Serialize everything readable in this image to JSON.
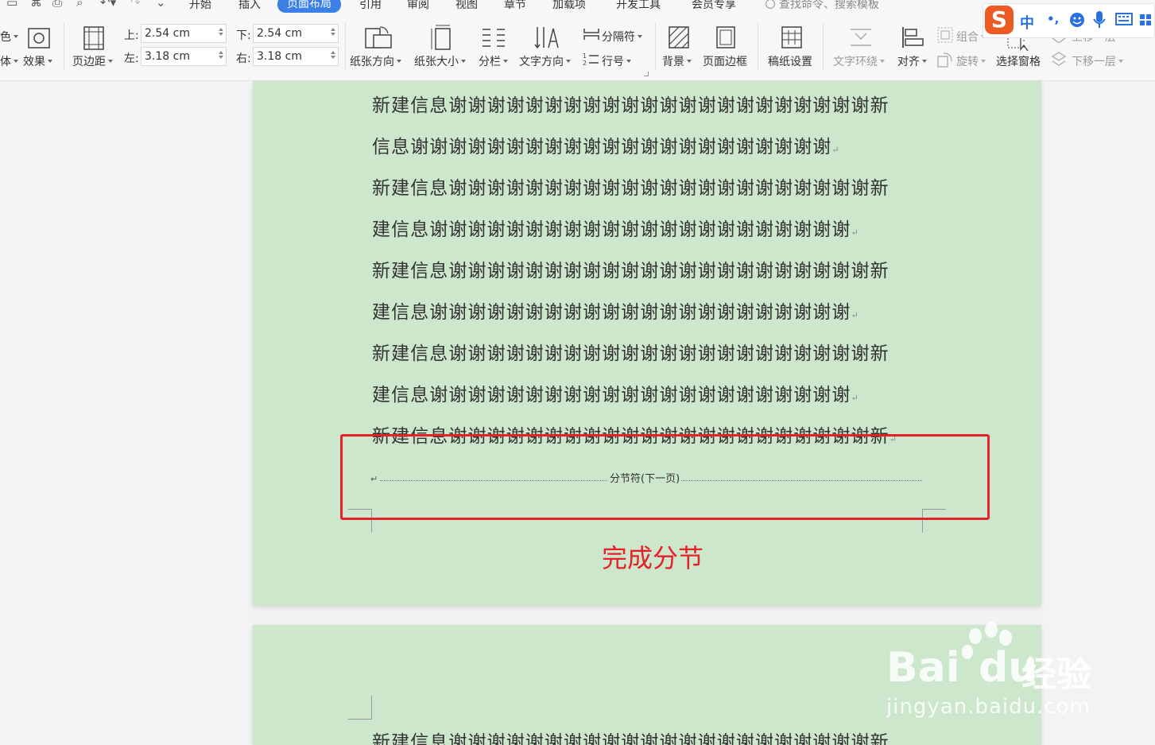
{
  "tabs": [
    {
      "label": "开始",
      "active": false
    },
    {
      "label": "插入",
      "active": false
    },
    {
      "label": "页面布局",
      "active": true
    },
    {
      "label": "引用",
      "active": false
    },
    {
      "label": "审阅",
      "active": false
    },
    {
      "label": "视图",
      "active": false
    },
    {
      "label": "章节",
      "active": false
    },
    {
      "label": "加载项",
      "active": false
    },
    {
      "label": "开发工具",
      "active": false
    },
    {
      "label": "会员专享",
      "active": false
    }
  ],
  "search_placeholder": "查找命令、搜索模板",
  "ribbon": {
    "left_cut_top": "色",
    "left_cut_bottom": "体",
    "effects": "效果",
    "margins": "页边距",
    "margin_top_label": "上:",
    "margin_top_value": "2.54 cm",
    "margin_bottom_label": "下:",
    "margin_bottom_value": "2.54 cm",
    "margin_left_label": "左:",
    "margin_left_value": "3.18 cm",
    "margin_right_label": "右:",
    "margin_right_value": "3.18 cm",
    "orientation": "纸张方向",
    "size": "纸张大小",
    "columns": "分栏",
    "text_direction": "文字方向",
    "breaks": "分隔符",
    "line_numbers": "行号",
    "background": "背景",
    "page_border": "页面边框",
    "manuscript": "稿纸设置",
    "wrap_text": "文字环绕",
    "align": "对齐",
    "group": "组合",
    "rotate": "旋转",
    "selection_pane": "选择窗格",
    "bring_forward": "上移一层",
    "send_backward": "下移一层"
  },
  "ime": {
    "logo": "S",
    "mode": "中",
    "punct": "•,"
  },
  "document": {
    "lines": [
      "新建信息谢谢谢谢谢谢谢谢谢谢谢谢谢谢谢谢谢谢谢谢谢谢新",
      "信息谢谢谢谢谢谢谢谢谢谢谢谢谢谢谢谢谢谢谢谢谢谢",
      "新建信息谢谢谢谢谢谢谢谢谢谢谢谢谢谢谢谢谢谢谢谢谢谢新",
      "建信息谢谢谢谢谢谢谢谢谢谢谢谢谢谢谢谢谢谢谢谢谢谢",
      "新建信息谢谢谢谢谢谢谢谢谢谢谢谢谢谢谢谢谢谢谢谢谢谢新",
      "建信息谢谢谢谢谢谢谢谢谢谢谢谢谢谢谢谢谢谢谢谢谢谢",
      "新建信息谢谢谢谢谢谢谢谢谢谢谢谢谢谢谢谢谢谢谢谢谢谢新",
      "建信息谢谢谢谢谢谢谢谢谢谢谢谢谢谢谢谢谢谢谢谢谢谢",
      "新建信息谢谢谢谢谢谢谢谢谢谢谢谢谢谢谢谢谢谢谢谢谢谢新"
    ],
    "section_break_label": "分节符(下一页)",
    "annotation": "完成分节",
    "page2_first_line": "新建信息谢谢谢谢谢谢谢谢谢谢谢谢谢谢谢谢谢谢谢谢谢谢新"
  },
  "watermark": {
    "brand": "Bai",
    "brand2": "经验",
    "url": "jingyan.baidu.com"
  },
  "colors": {
    "accent": "#3c7fe6",
    "page": "#cde7cd",
    "annotation": "#e8202a",
    "ime": "#ee5a24"
  }
}
